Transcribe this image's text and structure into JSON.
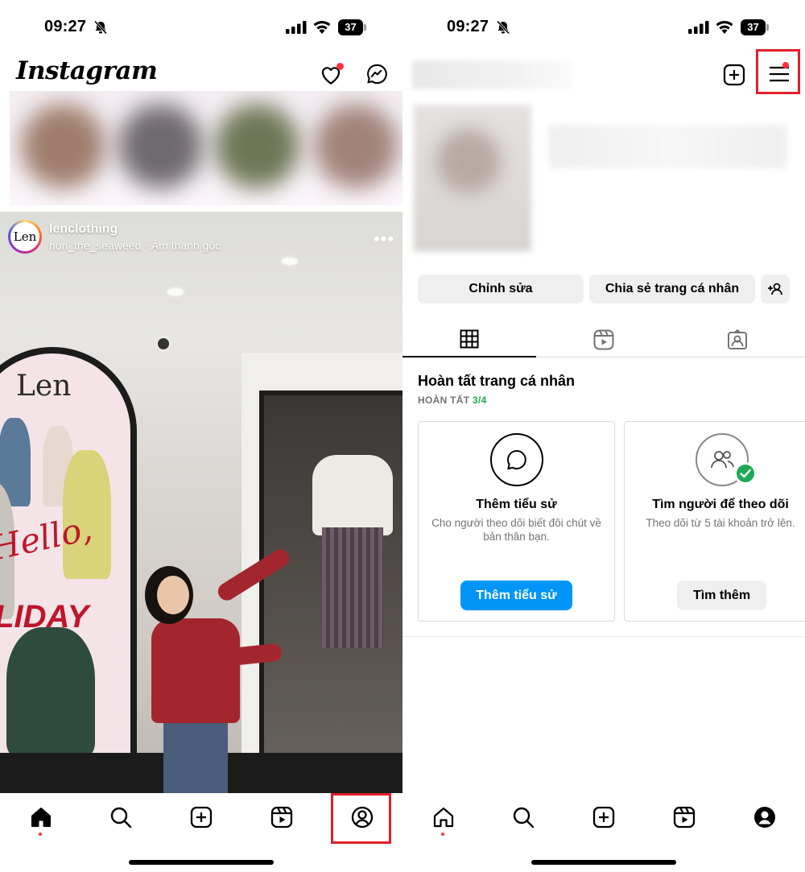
{
  "status_bar": {
    "time": "09:27",
    "battery": "37"
  },
  "feed": {
    "app_logo": "Instagram",
    "post": {
      "username": "lenclothing",
      "audio": "nori_the_seaweed · Âm thanh gốc",
      "avatar_text": "Len",
      "more": "•••",
      "photo_text": {
        "brand": "Len",
        "hello": "Hello,",
        "holiday": "OLIDAY"
      }
    }
  },
  "profile": {
    "edit_button": "Chỉnh sửa",
    "share_button": "Chia sẻ trang cá nhân",
    "complete": {
      "title": "Hoàn tất trang cá nhân",
      "status_label": "HOÀN TẤT",
      "status_value": "3/4"
    },
    "cards": [
      {
        "title": "Thêm tiểu sử",
        "desc": "Cho người theo dõi biết đôi chút về bản thân bạn.",
        "button": "Thêm tiểu sử",
        "icon": "speech-bubble-icon"
      },
      {
        "title": "Tìm người để theo dõi",
        "desc": "Theo dõi từ 5 tài khoản trở lên.",
        "button": "Tìm thêm",
        "icon": "people-icon"
      }
    ]
  },
  "nav_icons": [
    "home-icon",
    "search-icon",
    "create-icon",
    "reels-icon",
    "profile-icon"
  ],
  "colors": {
    "highlight": "#e0202a",
    "notification_dot": "#ff3040",
    "primary_button": "#0095f6",
    "complete_green": "#1ea954"
  }
}
